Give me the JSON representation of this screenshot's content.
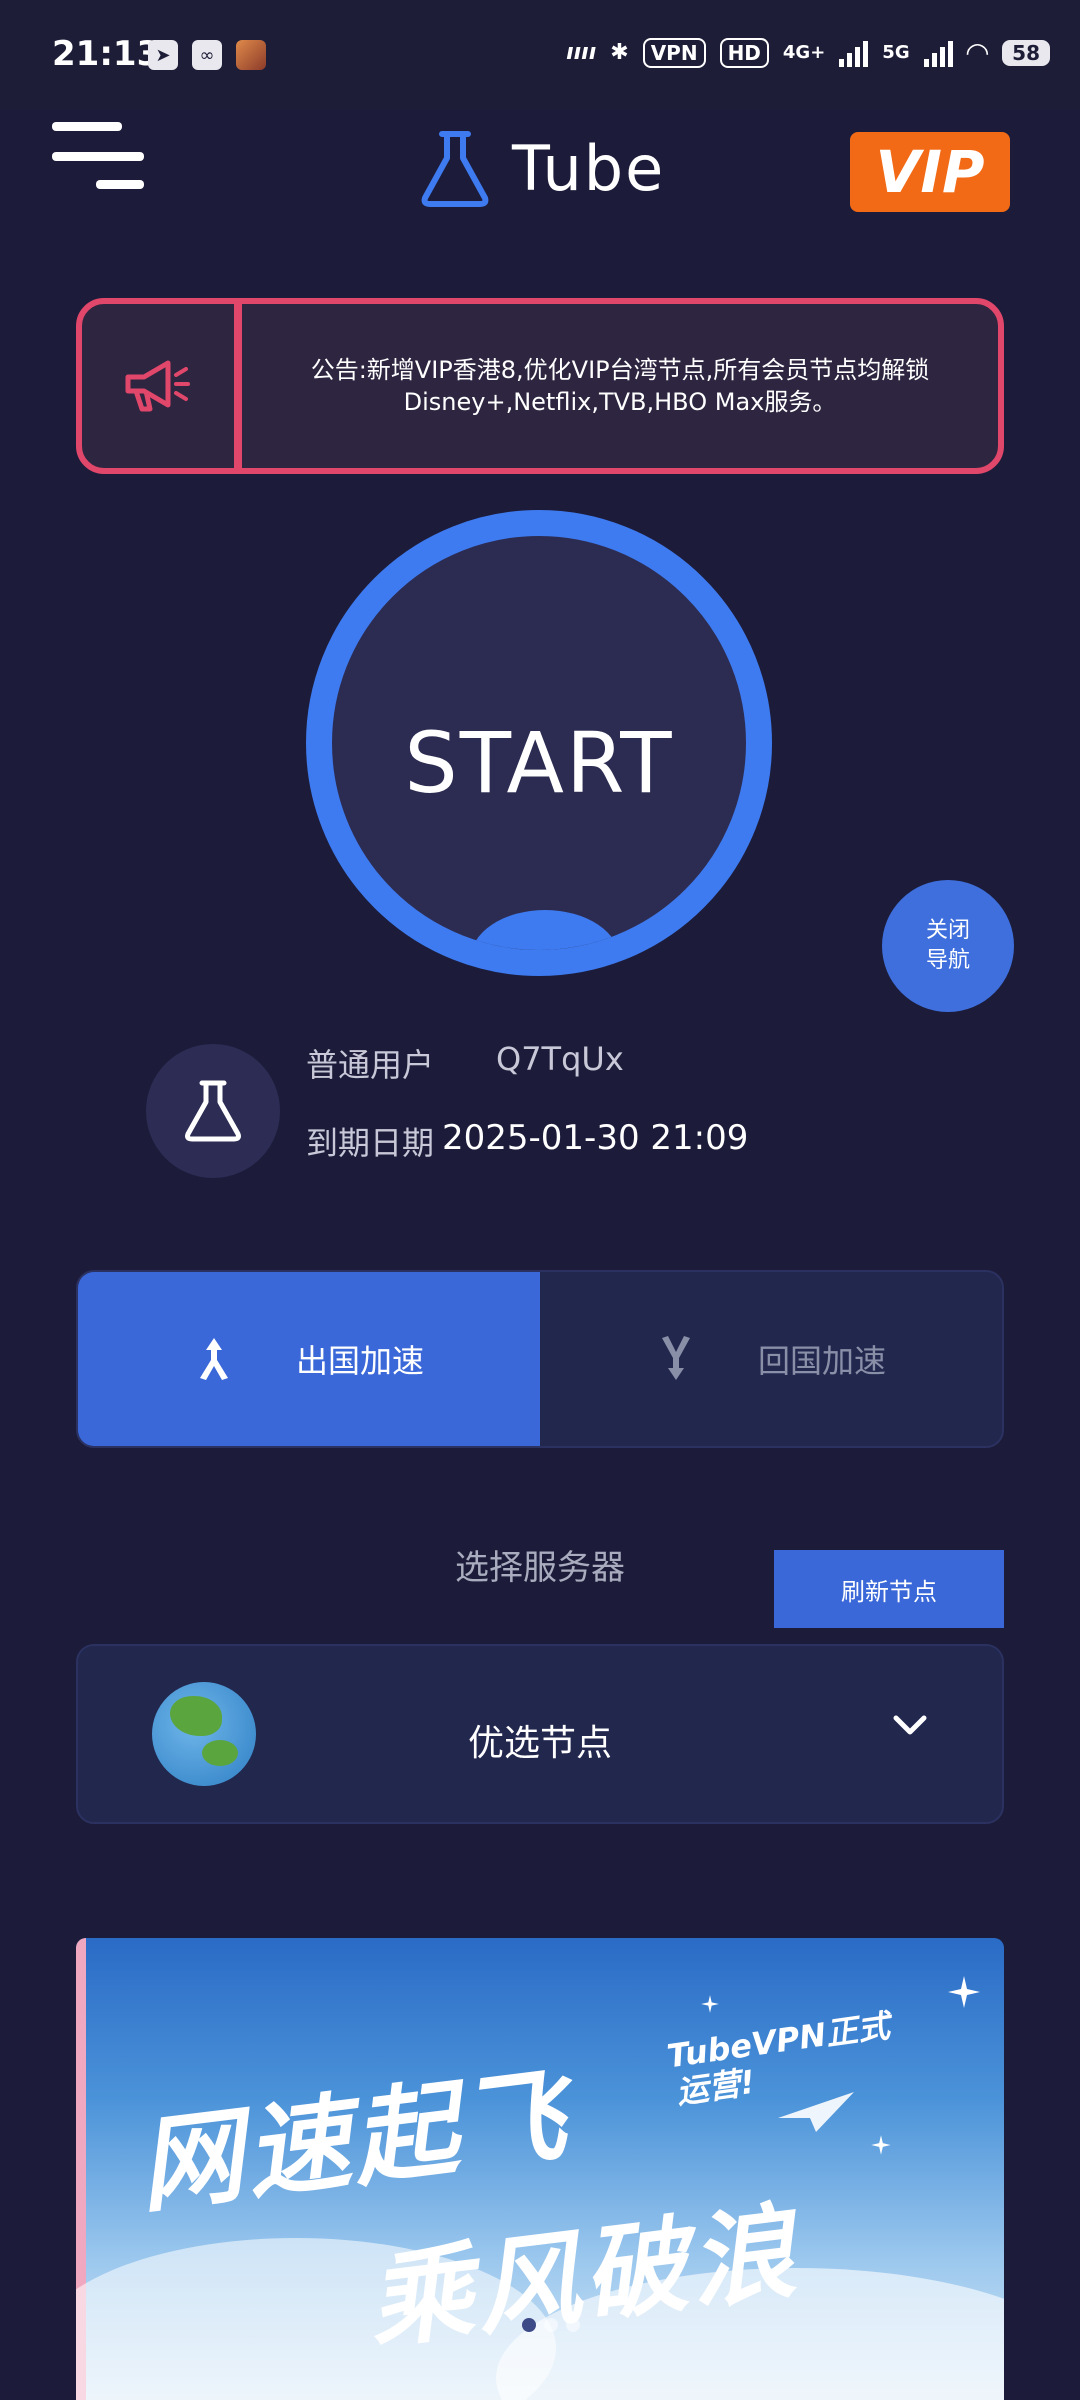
{
  "status_bar": {
    "time": "21:13",
    "vpn": "VPN",
    "hd": "HD",
    "net1": "4G+",
    "net2": "5G",
    "battery": "58"
  },
  "header": {
    "logo_text": "Tube",
    "vip_label": "VIP"
  },
  "notice": {
    "text": "公告:新增VIP香港8,优化VIP台湾节点,所有会员节点均解锁Disney+,Netflix,TVB,HBO Max服务。"
  },
  "start_button": {
    "label": "START"
  },
  "close_nav_button": {
    "line1": "关闭",
    "line2": "导航"
  },
  "user": {
    "type": "普通用户",
    "id": "Q7TqUx",
    "expiry_label": "到期日期",
    "expiry_value": "2025-01-30 21:09"
  },
  "mode_toggle": {
    "outbound_label": "出国加速",
    "inbound_label": "回国加速",
    "active": "outbound"
  },
  "server": {
    "title": "选择服务器",
    "refresh_label": "刷新节点",
    "selected": "优选节点"
  },
  "banner": {
    "line1": "网速起飞",
    "line2": "乘风破浪",
    "tag_line1": "TubeVPN正式",
    "tag_line2": "运营!",
    "active_dot": 0
  },
  "colors": {
    "background": "#1c1c3a",
    "accent_blue": "#3e7bf0",
    "notice_border": "#e0476a",
    "vip_orange": "#f26a16"
  }
}
